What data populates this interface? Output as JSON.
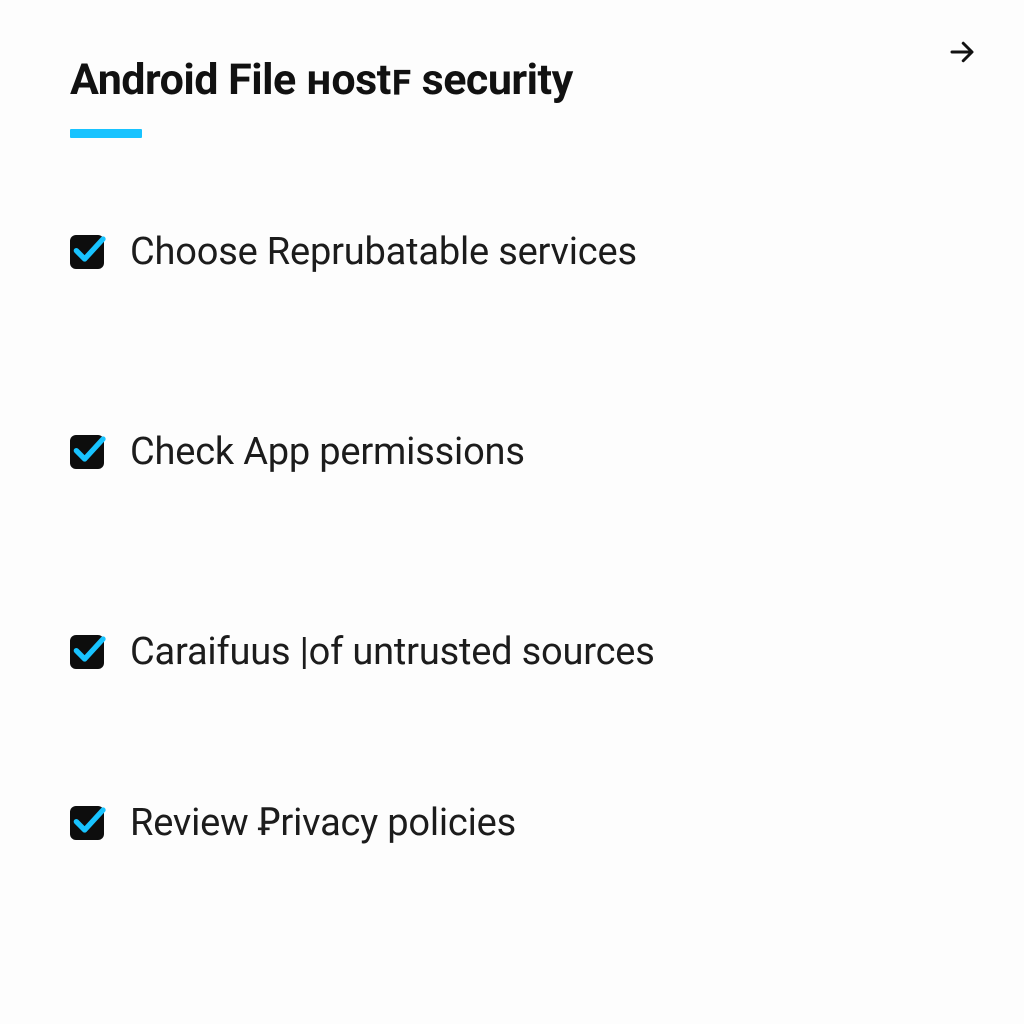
{
  "header": {
    "title": "Android File ʜostꜰ security"
  },
  "nav": {
    "next_icon": "arrow-right"
  },
  "checklist": {
    "items": [
      {
        "label": "Choose Reprubatable services"
      },
      {
        "label": "Check App permissions"
      },
      {
        "label": "Caraifuus |of untrusted sources"
      },
      {
        "label": "Review Ꝑrivacy policies"
      }
    ]
  },
  "colors": {
    "accent": "#18c3ff",
    "text": "#1a1a1a",
    "box": "#0d0d0d"
  }
}
